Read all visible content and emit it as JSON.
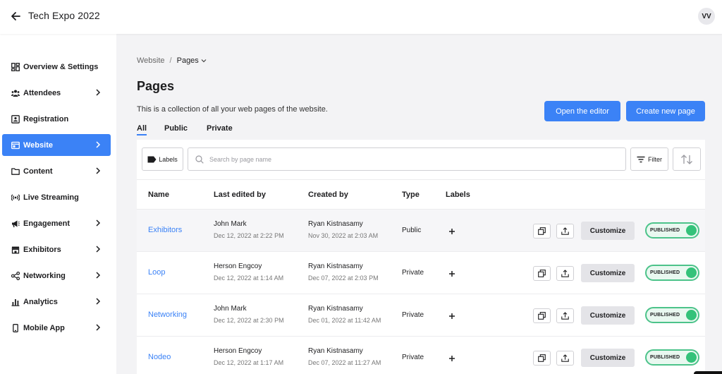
{
  "header": {
    "title": "Tech Expo 2022",
    "avatar_initials": "VV"
  },
  "sidebar": {
    "items": [
      {
        "label": "Overview & Settings",
        "icon": "dashboard-icon",
        "has_children": false,
        "active": false
      },
      {
        "label": "Attendees",
        "icon": "people-icon",
        "has_children": true,
        "active": false
      },
      {
        "label": "Registration",
        "icon": "id-card-icon",
        "has_children": false,
        "active": false
      },
      {
        "label": "Website",
        "icon": "browser-icon",
        "has_children": true,
        "active": true
      },
      {
        "label": "Content",
        "icon": "folder-icon",
        "has_children": true,
        "active": false
      },
      {
        "label": "Live Streaming",
        "icon": "broadcast-icon",
        "has_children": false,
        "active": false
      },
      {
        "label": "Engagement",
        "icon": "megaphone-icon",
        "has_children": true,
        "active": false
      },
      {
        "label": "Exhibitors",
        "icon": "store-icon",
        "has_children": true,
        "active": false
      },
      {
        "label": "Networking",
        "icon": "share-icon",
        "has_children": true,
        "active": false
      },
      {
        "label": "Analytics",
        "icon": "bar-chart-icon",
        "has_children": true,
        "active": false
      },
      {
        "label": "Mobile App",
        "icon": "mobile-icon",
        "has_children": true,
        "active": false
      }
    ]
  },
  "breadcrumb": {
    "parent": "Website",
    "separator": "/",
    "current": "Pages"
  },
  "page": {
    "title": "Pages",
    "description": "This is a collection of all your web pages of the website."
  },
  "tabs": [
    {
      "label": "All",
      "active": true
    },
    {
      "label": "Public",
      "active": false
    },
    {
      "label": "Private",
      "active": false
    }
  ],
  "actions": {
    "open_editor": "Open the editor",
    "create_page": "Create new page"
  },
  "toolbar": {
    "labels_button": "Labels",
    "search_placeholder": "Search by page name",
    "filter_button": "Filter"
  },
  "table": {
    "columns": {
      "name": "Name",
      "last_edited": "Last edited by",
      "created": "Created by",
      "type": "Type",
      "labels": "Labels"
    },
    "rows": [
      {
        "name": "Exhibitors",
        "edited_by": "John Mark",
        "edited_at": "Dec 12, 2022 at 2:22 PM",
        "created_by": "Ryan Kistnasamy",
        "created_at": "Nov 30, 2022 at 2:03 AM",
        "type": "Public",
        "customize": "Customize",
        "status": "PUBLISHED"
      },
      {
        "name": "Loop",
        "edited_by": "Herson Engcoy",
        "edited_at": "Dec 12, 2022 at 1:14 AM",
        "created_by": "Ryan Kistnasamy",
        "created_at": "Dec 07, 2022 at 2:03 PM",
        "type": "Private",
        "customize": "Customize",
        "status": "PUBLISHED"
      },
      {
        "name": "Networking",
        "edited_by": "John Mark",
        "edited_at": "Dec 12, 2022 at 2:30 PM",
        "created_by": "Ryan Kistnasamy",
        "created_at": "Dec 01, 2022 at 11:42 AM",
        "type": "Private",
        "customize": "Customize",
        "status": "PUBLISHED"
      },
      {
        "name": "Nodeo",
        "edited_by": "Herson Engcoy",
        "edited_at": "Dec 12, 2022 at 1:17 AM",
        "created_by": "Ryan Kistnasamy",
        "created_at": "Dec 07, 2022 at 11:27 AM",
        "type": "Private",
        "customize": "Customize",
        "status": "PUBLISHED"
      }
    ]
  },
  "colors": {
    "accent": "#3b82f6",
    "published_border": "#4cc38a",
    "published_knob": "#34c27a"
  }
}
